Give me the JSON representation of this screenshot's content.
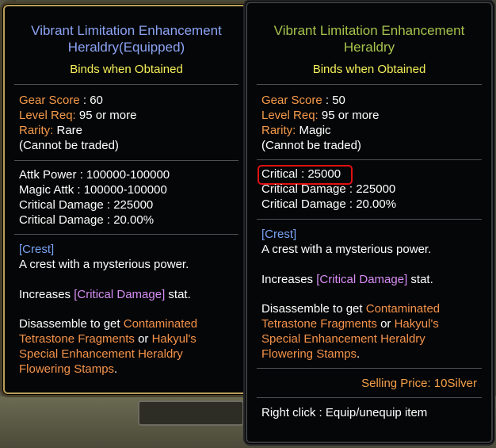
{
  "left_tooltip": {
    "title_line1": "Vibrant Limitation Enhancement",
    "title_line2": "Heraldry(Equipped)",
    "binds": "Binds when Obtained",
    "gear_score_label": "Gear Score",
    "gear_score_value": " : 60",
    "level_req_label": "Level Req:",
    "level_req_value": " 95 or more",
    "rarity_label": "Rarity:",
    "rarity_value": " Rare",
    "trade_note": "(Cannot be traded)",
    "stats": [
      "Attk Power : 100000-100000",
      "Magic Attk : 100000-100000",
      "Critical Damage : 225000",
      "Critical Damage : 20.00%"
    ],
    "crest_label": "[Crest]",
    "crest_desc": "A crest with a mysterious power.",
    "increases_prefix": "Increases ",
    "increases_stat": "[Critical Damage]",
    "increases_suffix": " stat.",
    "disassemble_prefix": "Disassemble to get ",
    "disassemble_item1_a": "Contaminated",
    "disassemble_item1_b": "Tetrastone Fragments",
    "disassemble_or": " or ",
    "disassemble_item2_a": "Hakyul's",
    "disassemble_item2_b": "Special Enhancement Heraldry",
    "disassemble_item2_c": "Flowering Stamps",
    "disassemble_end": "."
  },
  "right_tooltip": {
    "title_line1": "Vibrant Limitation Enhancement",
    "title_line2": "Heraldry",
    "binds": "Binds when Obtained",
    "gear_score_label": "Gear Score",
    "gear_score_value": " : 50",
    "level_req_label": "Level Req:",
    "level_req_value": " 95 or more",
    "rarity_label": "Rarity:",
    "rarity_value": " Magic",
    "trade_note": "(Cannot be traded)",
    "stats": [
      "Critical : 25000",
      "Critical Damage : 225000",
      "Critical Damage : 20.00%"
    ],
    "crest_label": "[Crest]",
    "crest_desc": "A crest with a mysterious power.",
    "increases_prefix": "Increases ",
    "increases_stat": "[Critical Damage]",
    "increases_suffix": " stat.",
    "disassemble_prefix": "Disassemble to get ",
    "disassemble_item1_a": "Contaminated",
    "disassemble_item1_b": "Tetrastone Fragments",
    "disassemble_or": " or ",
    "disassemble_item2_a": "Hakyul's",
    "disassemble_item2_b": "Special Enhancement Heraldry",
    "disassemble_item2_c": "Flowering Stamps",
    "disassemble_end": ".",
    "selling_price": "Selling Price: 10Silver",
    "right_click_hint": "Right click : Equip/unequip item"
  },
  "colors": {
    "equipped_title": "#8ba3f4",
    "unequipped_title": "#a6c34d",
    "binds": "#f5f05a",
    "label_orange": "#f59a4a",
    "crest_blue": "#79a3f5",
    "crit_purple": "#d88df5",
    "highlight_red": "#e01010"
  }
}
